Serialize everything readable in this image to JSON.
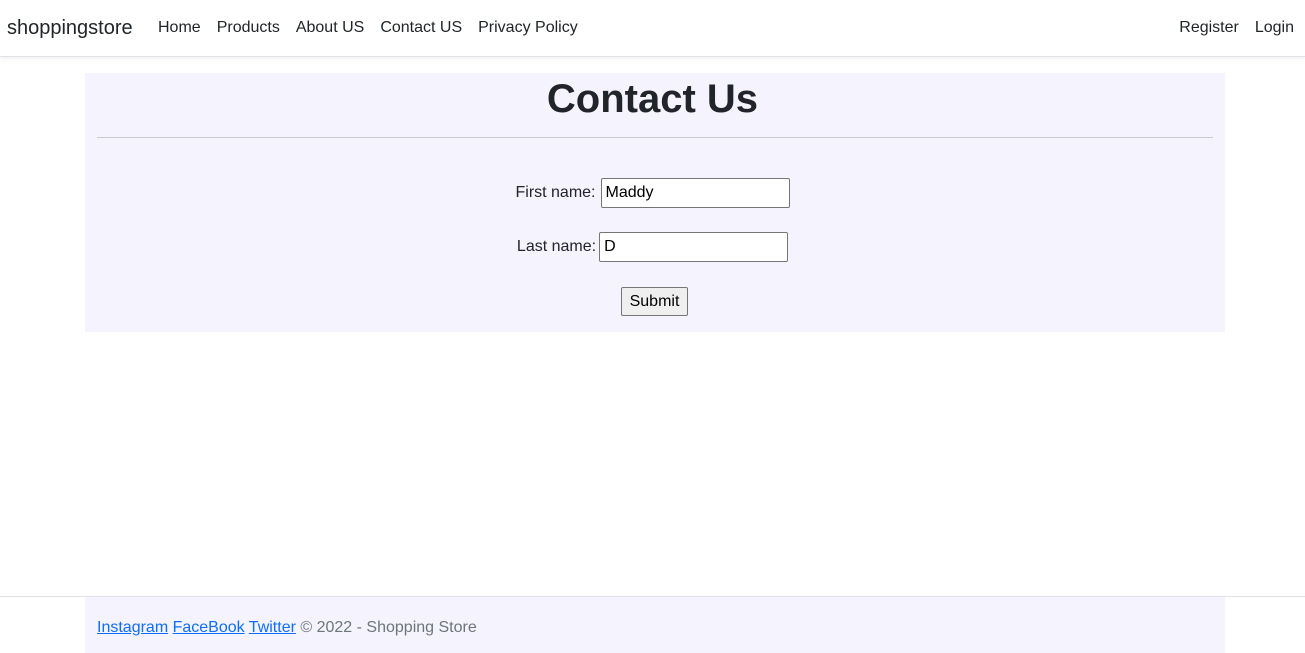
{
  "navbar": {
    "brand": "shoppingstore",
    "left_links": [
      "Home",
      "Products",
      "About US",
      "Contact US",
      "Privacy Policy"
    ],
    "right_links": [
      "Register",
      "Login"
    ]
  },
  "main": {
    "title": "Contact Us",
    "form": {
      "first_name_label": "First name:",
      "first_name_value": "Maddy",
      "last_name_label": "Last name:",
      "last_name_value": "D",
      "submit_label": "Submit"
    }
  },
  "footer": {
    "links": [
      "Instagram",
      "FaceBook",
      "Twitter"
    ],
    "copyright": "© 2022 - Shopping Store"
  },
  "colors": {
    "panel_background": "#f5f3fd",
    "link": "#0d6efd",
    "muted_text": "#6c757d"
  }
}
